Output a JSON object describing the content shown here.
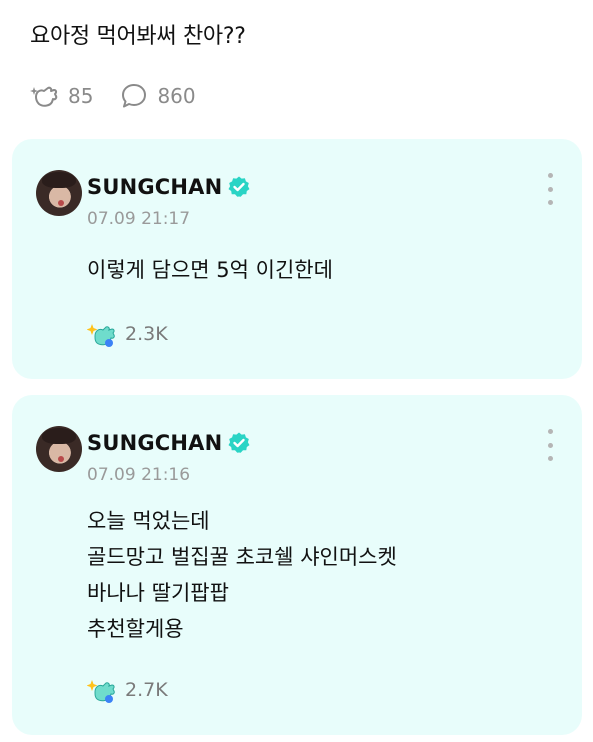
{
  "post": {
    "title": "요아정 먹어봐써 찬아??",
    "likes_icon": "sparkle-hand-icon",
    "likes_count": "85",
    "comments_icon": "speech-bubble-icon",
    "comments_count": "860"
  },
  "replies": [
    {
      "author": "SUNGCHAN",
      "verified_icon": "verified-badge-icon",
      "timestamp": "07.09 21:17",
      "lines": [
        "이렇게 담으면 5억 이긴한데"
      ],
      "reaction_icon": "sparkle-hand-icon",
      "reaction_count": "2.3K"
    },
    {
      "author": "SUNGCHAN",
      "verified_icon": "verified-badge-icon",
      "timestamp": "07.09 21:16",
      "lines": [
        "오늘 먹었는데",
        "골드망고 벌집꿀 초코쉘 샤인머스켓",
        "바나나 딸기팝팝",
        "추천할게용"
      ],
      "reaction_icon": "sparkle-hand-icon",
      "reaction_count": "2.7K"
    }
  ],
  "colors": {
    "card_background": "#e8fdfb",
    "verified_badge": "#2ad4c5",
    "muted_text": "#9a9a9a"
  }
}
